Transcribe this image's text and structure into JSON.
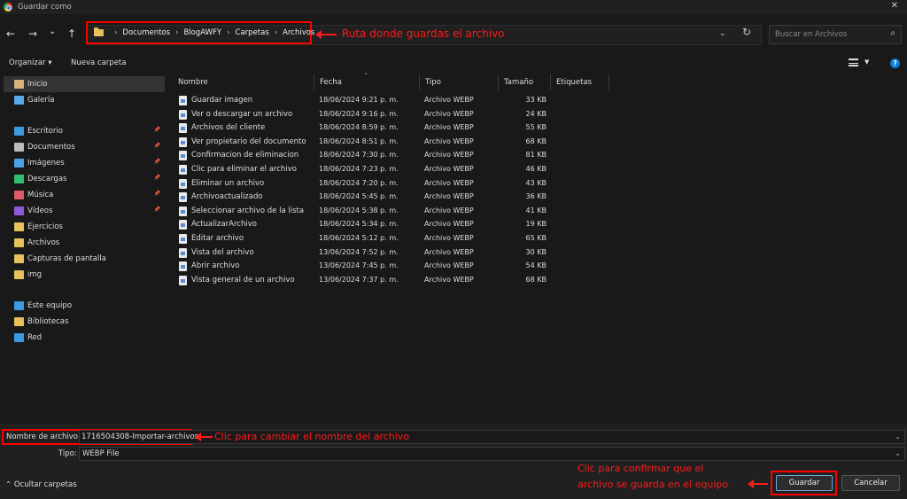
{
  "window": {
    "title": "Guardar como",
    "close": "✕"
  },
  "nav": {
    "back": "←",
    "forward": "→",
    "dropdown": "⌄",
    "up": "↑"
  },
  "breadcrumb": [
    "Documentos",
    "BlogAWFY",
    "Carpetas",
    "Archivos"
  ],
  "search": {
    "placeholder": "Buscar en Archivos"
  },
  "toolbar": {
    "organize": "Organizar ▾",
    "new_folder": "Nueva carpeta"
  },
  "sidebar": {
    "items": [
      {
        "label": "Inicio",
        "icon": "home-icon",
        "color": "#d8b37a"
      },
      {
        "label": "Galería",
        "icon": "gallery-icon",
        "color": "#5aa8e8"
      },
      {
        "label": "Escritorio",
        "icon": "desktop-icon",
        "color": "#3b9be0",
        "pinned": true
      },
      {
        "label": "Documentos",
        "icon": "documents-icon",
        "color": "#bbbbbb",
        "pinned": true
      },
      {
        "label": "Imágenes",
        "icon": "pictures-icon",
        "color": "#4aa3e8",
        "pinned": true
      },
      {
        "label": "Descargas",
        "icon": "downloads-icon",
        "color": "#2fbf71",
        "pinned": true
      },
      {
        "label": "Música",
        "icon": "music-icon",
        "color": "#e05a6b",
        "pinned": true
      },
      {
        "label": "Vídeos",
        "icon": "videos-icon",
        "color": "#8a5ad8",
        "pinned": true
      },
      {
        "label": "Ejercicios",
        "icon": "folder-icon",
        "color": "#e8c15a"
      },
      {
        "label": "Archivos",
        "icon": "folder-icon",
        "color": "#e8c15a"
      },
      {
        "label": "Capturas de pantalla",
        "icon": "folder-icon",
        "color": "#e8c15a"
      },
      {
        "label": "img",
        "icon": "folder-icon",
        "color": "#e8c15a"
      },
      {
        "label": "Este equipo",
        "icon": "computer-icon",
        "color": "#3b9be0"
      },
      {
        "label": "Bibliotecas",
        "icon": "libraries-icon",
        "color": "#e8c15a"
      },
      {
        "label": "Red",
        "icon": "network-icon",
        "color": "#3b9be0"
      }
    ]
  },
  "columns": {
    "name": "Nombre",
    "date": "Fecha",
    "type": "Tipo",
    "size": "Tamaño",
    "tags": "Etiquetas"
  },
  "files": [
    {
      "name": "Guardar imagen",
      "date": "18/06/2024 9:21 p. m.",
      "type": "Archivo WEBP",
      "size": "33 KB"
    },
    {
      "name": "Ver o descargar un archivo",
      "date": "18/06/2024 9:16 p. m.",
      "type": "Archivo WEBP",
      "size": "24 KB"
    },
    {
      "name": "Archivos del cliente",
      "date": "18/06/2024 8:59 p. m.",
      "type": "Archivo WEBP",
      "size": "55 KB"
    },
    {
      "name": "Ver propietario del documento",
      "date": "18/06/2024 8:51 p. m.",
      "type": "Archivo WEBP",
      "size": "68 KB"
    },
    {
      "name": "Confirmacion de eliminacion",
      "date": "18/06/2024 7:30 p. m.",
      "type": "Archivo WEBP",
      "size": "81 KB"
    },
    {
      "name": "Clic para eliminar el archivo",
      "date": "18/06/2024 7:23 p. m.",
      "type": "Archivo WEBP",
      "size": "46 KB"
    },
    {
      "name": "Eliminar un archivo",
      "date": "18/06/2024 7:20 p. m.",
      "type": "Archivo WEBP",
      "size": "43 KB"
    },
    {
      "name": "Archivoactualizado",
      "date": "18/06/2024 5:45 p. m.",
      "type": "Archivo WEBP",
      "size": "36 KB"
    },
    {
      "name": "Seleccionar archivo de la lista",
      "date": "18/06/2024 5:38 p. m.",
      "type": "Archivo WEBP",
      "size": "41 KB"
    },
    {
      "name": "ActualizarArchivo",
      "date": "18/06/2024 5:34 p. m.",
      "type": "Archivo WEBP",
      "size": "19 KB"
    },
    {
      "name": "Editar archivo",
      "date": "18/06/2024 5:12 p. m.",
      "type": "Archivo WEBP",
      "size": "65 KB"
    },
    {
      "name": "Vista del archivo",
      "date": "13/06/2024 7:52 p. m.",
      "type": "Archivo WEBP",
      "size": "30 KB"
    },
    {
      "name": "Abrir archivo",
      "date": "13/06/2024 7:45 p. m.",
      "type": "Archivo WEBP",
      "size": "54 KB"
    },
    {
      "name": "Vista general de un archivo",
      "date": "13/06/2024 7:37 p. m.",
      "type": "Archivo WEBP",
      "size": "68 KB"
    }
  ],
  "form": {
    "name_label": "Nombre de archivo:",
    "name_value": "1716504308-Importar-archivos",
    "type_label": "Tipo:",
    "type_value": "WEBP File"
  },
  "buttons": {
    "save": "Guardar",
    "cancel": "Cancelar",
    "hide_folders": "Ocultar carpetas"
  },
  "annotations": {
    "path": "Ruta donde guardas el archivo",
    "name": "Clic para cambiar el nombre del archivo",
    "confirm_line1": "Clic para confirmar que el",
    "confirm_line2": "archivo se guarda en el equipo"
  },
  "colors": {
    "annotation": "#ff1a1a",
    "folder": "#e8c15a",
    "help": "#0a7fd8"
  }
}
